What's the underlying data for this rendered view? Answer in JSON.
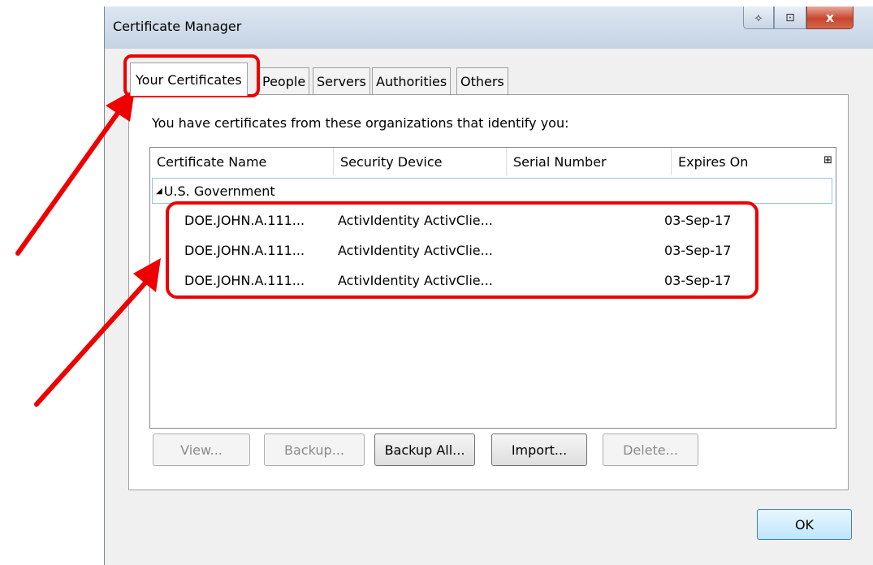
{
  "window": {
    "title": "Certificate Manager",
    "titlebar_buttons": {
      "move_icon": "⟡",
      "restore_icon": "⊡",
      "close": "x"
    }
  },
  "tabs": [
    {
      "label": "Your Certificates",
      "active": true
    },
    {
      "label": "People",
      "active": false
    },
    {
      "label": "Servers",
      "active": false
    },
    {
      "label": "Authorities",
      "active": false
    },
    {
      "label": "Others",
      "active": false
    }
  ],
  "intro_text": "You have certificates from these organizations that identify you:",
  "columns": [
    "Certificate Name",
    "Security Device",
    "Serial Number",
    "Expires On"
  ],
  "column_picker_icon": "⊞",
  "group": {
    "toggle": "◢",
    "name": "U.S. Government"
  },
  "certificates": [
    {
      "name": "DOE.JOHN.A.111...",
      "device": "ActivIdentity ActivClie...",
      "serial": "",
      "expires": "03-Sep-17"
    },
    {
      "name": "DOE.JOHN.A.111...",
      "device": "ActivIdentity ActivClie...",
      "serial": "",
      "expires": "03-Sep-17"
    },
    {
      "name": "DOE.JOHN.A.111...",
      "device": "ActivIdentity ActivClie...",
      "serial": "",
      "expires": "03-Sep-17"
    }
  ],
  "buttons": {
    "view": {
      "label": "View...",
      "enabled": false
    },
    "backup": {
      "label": "Backup...",
      "enabled": false
    },
    "backup_all": {
      "label": "Backup All...",
      "enabled": true
    },
    "import": {
      "label": "Import...",
      "enabled": true
    },
    "delete": {
      "label": "Delete...",
      "enabled": false
    },
    "ok": {
      "label": "OK",
      "enabled": true
    }
  },
  "annotation_color": "#ee0000"
}
